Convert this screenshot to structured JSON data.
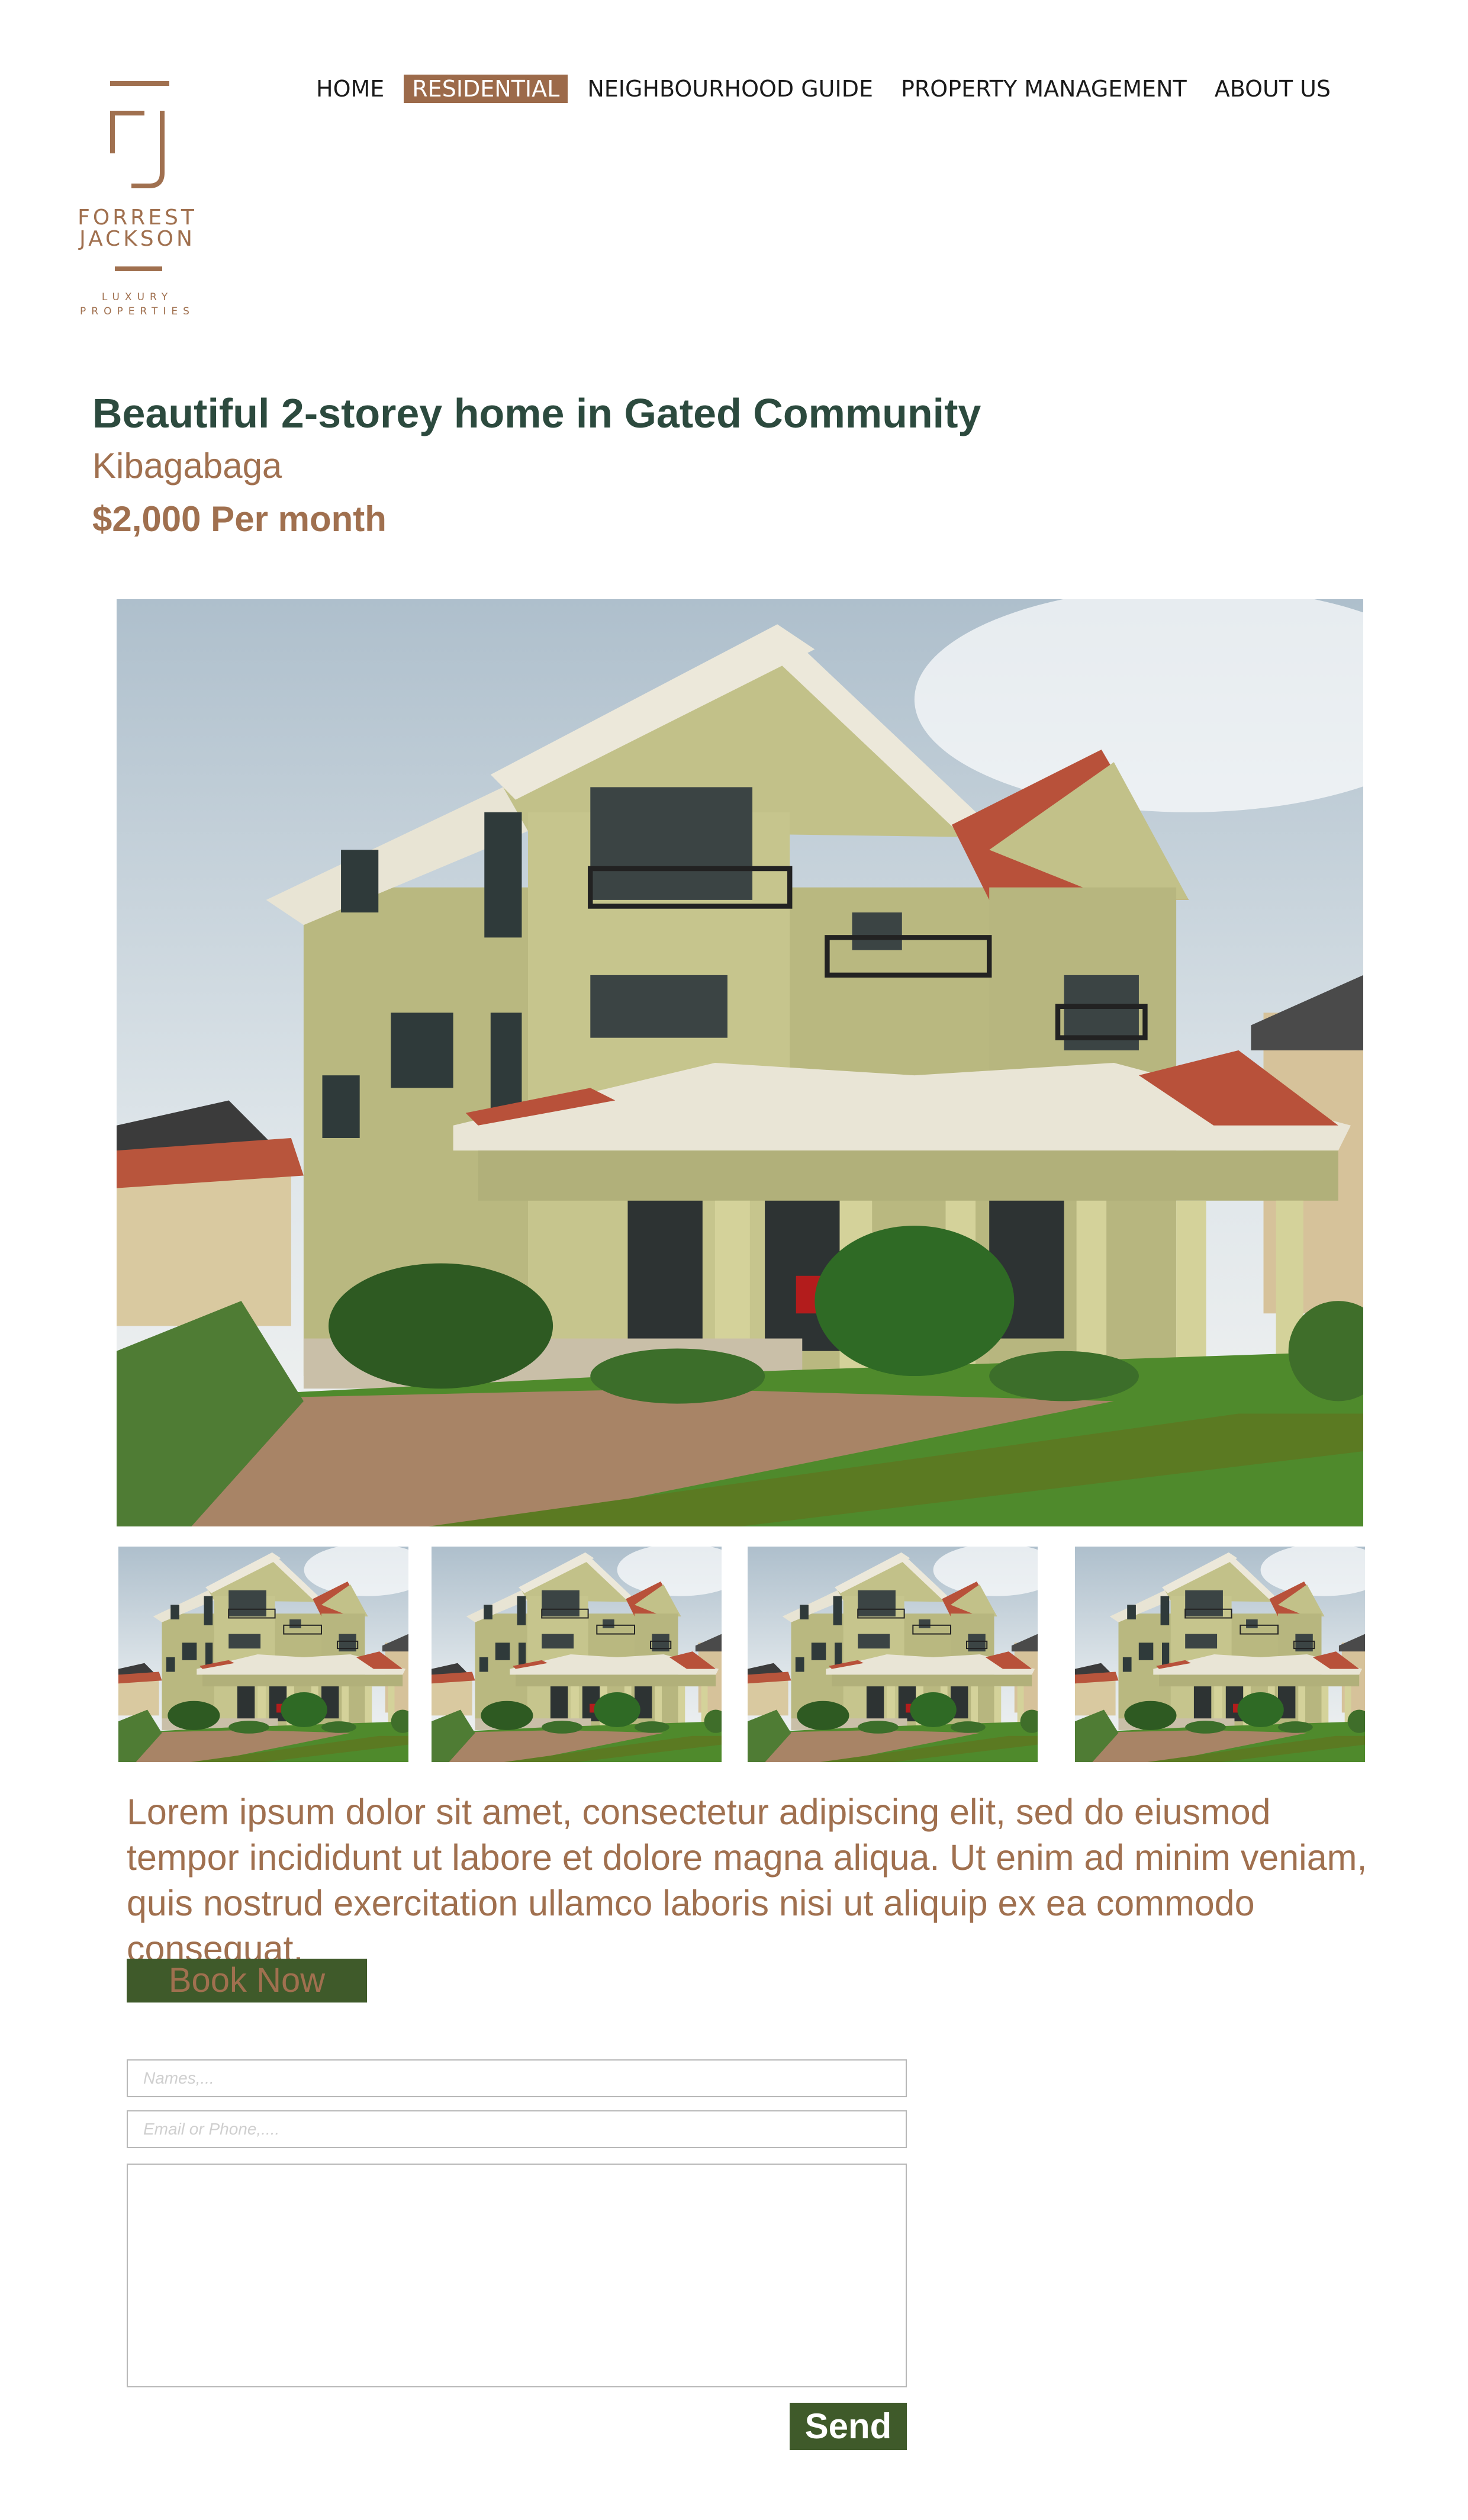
{
  "brand": {
    "name_line1": "FORREST",
    "name_line2": "JACKSON",
    "tagline_line1": "LUXURY",
    "tagline_line2": "PROPERTIES",
    "color": "#a0704f"
  },
  "nav": {
    "items": [
      {
        "label": "HOME",
        "active": false
      },
      {
        "label": "RESIDENTIAL",
        "active": true
      },
      {
        "label": "NEIGHBOURHOOD GUIDE",
        "active": false
      },
      {
        "label": "PROPERTY MANAGEMENT",
        "active": false
      },
      {
        "label": "ABOUT US",
        "active": false
      }
    ],
    "active_color": "#9c6a4a"
  },
  "listing": {
    "title": "Beautiful 2-storey home in Gated Community",
    "location": "Kibagabaga",
    "price": "$2,000 Per month",
    "description": "Lorem ipsum dolor sit amet, consectetur adipiscing elit, sed do eiusmod tempor incididunt ut labore et dolore magna aliqua. Ut enim ad minim veniam, quis nostrud exercitation ullamco laboris nisi ut aliquip ex ea commodo consequat.",
    "main_image_icon": "house-photo",
    "thumbnail_count": 4
  },
  "actions": {
    "book_label": "Book Now",
    "send_label": "Send",
    "button_color": "#3f5a2a"
  },
  "form": {
    "names_placeholder": "Names,...",
    "contact_placeholder": "Email or Phone,....",
    "names_value": "",
    "contact_value": "",
    "message_value": ""
  },
  "colors": {
    "title": "#2c4a3e",
    "accent": "#a0704f"
  }
}
